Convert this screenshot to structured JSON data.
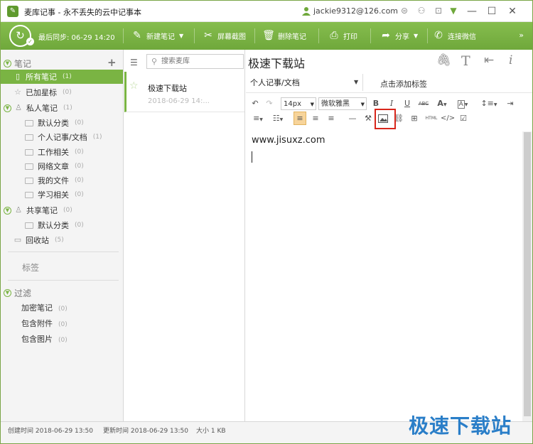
{
  "titlebar": {
    "app_title": "麦库记事 - 永不丢失的云中记事本",
    "user_email": "jackie9312@126.com"
  },
  "toolbar": {
    "last_sync": "最后同步: 06-29 14:20",
    "new_note": "新建笔记",
    "screenshot": "屏幕截图",
    "delete_note": "删除笔记",
    "print": "打印",
    "share": "分享",
    "wechat": "连接微信"
  },
  "sidebar": {
    "notes_header": "笔记",
    "items": [
      {
        "label": "所有笔记",
        "count": "(1)"
      },
      {
        "label": "已加星标",
        "count": "(0)"
      },
      {
        "label": "私人笔记",
        "count": "(1)"
      },
      {
        "label": "默认分类",
        "count": "(0)"
      },
      {
        "label": "个人记事/文档",
        "count": "(1)"
      },
      {
        "label": "工作相关",
        "count": "(0)"
      },
      {
        "label": "网络文章",
        "count": "(0)"
      },
      {
        "label": "我的文件",
        "count": "(0)"
      },
      {
        "label": "学习相关",
        "count": "(0)"
      },
      {
        "label": "共享笔记",
        "count": "(0)"
      },
      {
        "label": "默认分类",
        "count": "(0)"
      },
      {
        "label": "回收站",
        "count": "(5)"
      }
    ],
    "tags_header": "标签",
    "filter_header": "过滤",
    "filters": [
      {
        "label": "加密笔记",
        "count": "(0)"
      },
      {
        "label": "包含附件",
        "count": "(0)"
      },
      {
        "label": "包含图片",
        "count": "(0)"
      }
    ]
  },
  "list": {
    "search_placeholder": "搜索麦库",
    "notes": [
      {
        "title": "极速下载站",
        "date": "2018-06-29 14:..."
      }
    ]
  },
  "editor": {
    "title": "极速下载站",
    "notebook": "个人记事/文档",
    "add_tag": "点击添加标签",
    "font_size": "14px",
    "font_family": "微软雅黑",
    "content": "www.jisuxz.com"
  },
  "status": {
    "created": "创建时间 2018-06-29 13:50",
    "modified": "更新时间 2018-06-29 13:50",
    "size": "大小 1 KB"
  },
  "watermark": "极速下载站",
  "colors": {
    "accent": "#7ab443",
    "highlight": "#d8261b",
    "watermark": "#2a7ec8"
  }
}
